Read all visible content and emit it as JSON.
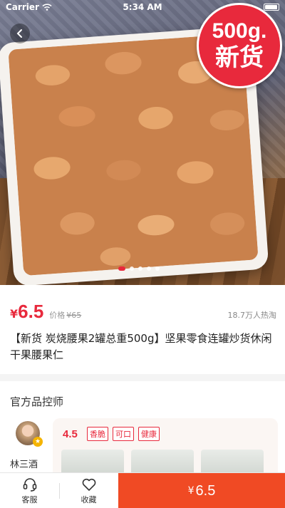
{
  "status_bar": {
    "carrier": "Carrier",
    "time": "5:34 AM"
  },
  "hero": {
    "badge_line1": "500g.",
    "badge_line2": "新货",
    "slide_count": 5,
    "active_slide": 1
  },
  "product": {
    "currency": "¥",
    "price": "6.5",
    "original_label": "价格",
    "original_price": "¥65",
    "popularity": "18.7万人热淘",
    "title": "【新货 炭烧腰果2罐总重500g】坚果零食连罐炒货休闲干果腰果仁"
  },
  "expert": {
    "heading": "官方品控师",
    "name": "林三酒",
    "score": "4.5",
    "tags": [
      "香脆",
      "可口",
      "健康"
    ]
  },
  "bottom_bar": {
    "service_label": "客服",
    "favorite_label": "收藏",
    "buy_currency": "¥",
    "buy_price": "6.5"
  },
  "colors": {
    "accent": "#e8293c",
    "buy_button": "#f04a24"
  }
}
